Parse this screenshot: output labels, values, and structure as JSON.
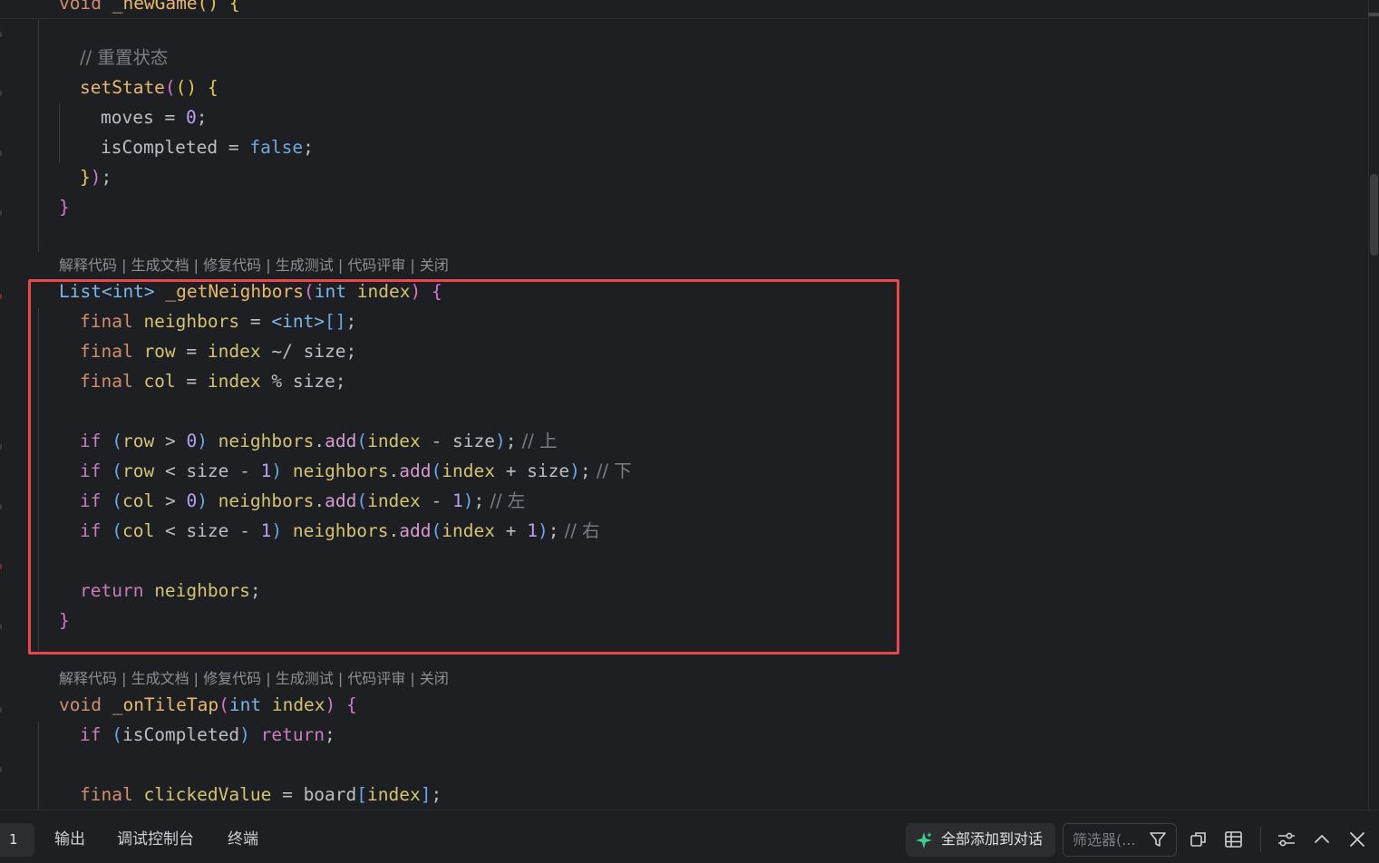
{
  "editor": {
    "lines": {
      "l0_void": "void",
      "l0_name": " _newGame",
      "l0_paren": "()",
      "l0_brace": " {",
      "l2_comment": "// 重置状态",
      "l3_fn": "setState",
      "l3_p1": "(",
      "l3_p2": "()",
      "l3_brace": " {",
      "l4_var": "moves",
      "l4_eq": " = ",
      "l4_num": "0",
      "l4_semi": ";",
      "l5_var": "isCompleted",
      "l5_eq": " = ",
      "l5_lit": "false",
      "l5_semi": ";",
      "l6_brace": "}",
      "l6_paren": ")",
      "l6_semi": ";",
      "l7_brace": "}",
      "g_type": "List<int>",
      "g_name": " _getNeighbors",
      "g_p1": "(",
      "g_ptype": "int",
      "g_pname": " index",
      "g_p2": ")",
      "g_brace": " {",
      "n1_kw": "final",
      "n1_var": " neighbors",
      "n1_eq": " = ",
      "n1_type": "<int>",
      "n1_br": "[]",
      "n1_semi": ";",
      "n2_kw": "final",
      "n2_var": " row",
      "n2_eq": " = ",
      "n2_idx": "index",
      "n2_rest": " ~/ size;",
      "n3_kw": "final",
      "n3_var": " col",
      "n3_eq": " = ",
      "n3_idx": "index",
      "n3_rest": " % size;",
      "i1_kw": "if",
      "i1_p1": " (",
      "i1_var": "row",
      "i1_op": " > ",
      "i1_num": "0",
      "i1_p2": ")",
      "i1_nb": " neighbors",
      "i1_dot": ".",
      "i1_add": "add",
      "i1_p3": "(",
      "i1_idx": "index",
      "i1_op2": " - size",
      "i1_p4": ")",
      "i1_semi": ";",
      "i1_cm": " // 上",
      "i2_kw": "if",
      "i2_p1": " (",
      "i2_var": "row",
      "i2_op": " < size - ",
      "i2_num": "1",
      "i2_p2": ")",
      "i2_nb": " neighbors",
      "i2_dot": ".",
      "i2_add": "add",
      "i2_p3": "(",
      "i2_idx": "index",
      "i2_op2": " + size",
      "i2_p4": ")",
      "i2_semi": ";",
      "i2_cm": " // 下",
      "i3_kw": "if",
      "i3_p1": " (",
      "i3_var": "col",
      "i3_op": " > ",
      "i3_num": "0",
      "i3_p2": ")",
      "i3_nb": " neighbors",
      "i3_dot": ".",
      "i3_add": "add",
      "i3_p3": "(",
      "i3_idx": "index",
      "i3_op2": " - ",
      "i3_num2": "1",
      "i3_p4": ")",
      "i3_semi": ";",
      "i3_cm": " // 左",
      "i4_kw": "if",
      "i4_p1": " (",
      "i4_var": "col",
      "i4_op": " < size - ",
      "i4_num": "1",
      "i4_p2": ")",
      "i4_nb": " neighbors",
      "i4_dot": ".",
      "i4_add": "add",
      "i4_p3": "(",
      "i4_idx": "index",
      "i4_op2": " + ",
      "i4_num2": "1",
      "i4_p4": ")",
      "i4_semi": ";",
      "i4_cm": " // 右",
      "r_kw": "return",
      "r_var": " neighbors",
      "r_semi": ";",
      "g_close": "}",
      "t_void": "void",
      "t_name": " _onTileTap",
      "t_p1": "(",
      "t_ptype": "int",
      "t_pname": " index",
      "t_p2": ")",
      "t_brace": " {",
      "t1_kw": "if",
      "t1_p1": " (",
      "t1_var": "isCompleted",
      "t1_p2": ")",
      "t1_ret": " return",
      "t1_semi": ";",
      "t2_kw": "final",
      "t2_var": " clickedValue",
      "t2_eq": " = ",
      "t2_board": "board",
      "t2_b1": "[",
      "t2_idx": "index",
      "t2_b2": "]",
      "t2_semi": ";"
    },
    "code_lens": {
      "explain": "解释代码",
      "docs": "生成文档",
      "fix": "修复代码",
      "test": "生成测试",
      "review": "代码评审",
      "close": "关闭",
      "sep": " | "
    }
  },
  "bottom_panel": {
    "problems_count": "1",
    "tabs": {
      "output": "输出",
      "debug_console": "调试控制台",
      "terminal": "终端"
    },
    "add_all_label": "全部添加到对话",
    "filter_placeholder": "筛选器(..."
  },
  "colors": {
    "highlight_border": "#e8484a",
    "background": "#1e1f22",
    "accent_green": "#3fd18a"
  }
}
